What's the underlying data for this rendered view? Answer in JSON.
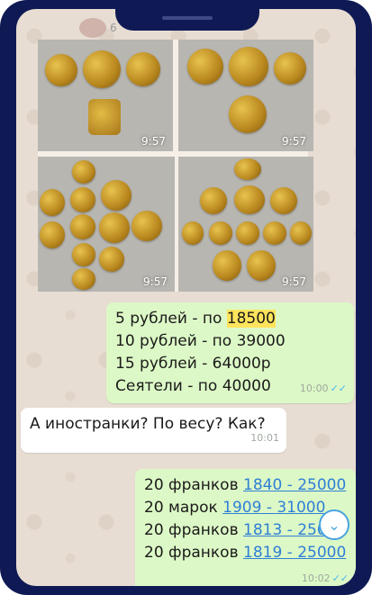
{
  "header": {
    "avatar_caption": "6"
  },
  "photos": [
    {
      "time": "9:57"
    },
    {
      "time": "9:57"
    },
    {
      "time": "9:57"
    },
    {
      "time": "9:57"
    }
  ],
  "msg_prices": {
    "line1_prefix": "5 рублей - по ",
    "line1_value": "18500",
    "line2": "10 рублей - по 39000",
    "line3": "15 рублей - 64000р",
    "line4": "Сеятели - по 40000",
    "time": "10:00",
    "ticks": "✓✓"
  },
  "msg_question": {
    "text": "А иностранки? По весу? Как?",
    "time": "10:01"
  },
  "msg_links": {
    "rows": [
      {
        "prefix": "20 франков ",
        "link": "1840 - 25000"
      },
      {
        "prefix": "20 марок ",
        "link": "1909 - 31000"
      },
      {
        "prefix": "20 франков ",
        "link": "1813 - 2500"
      },
      {
        "prefix": "20 франков ",
        "link": "1819 - 25000"
      }
    ],
    "time": "10:02",
    "ticks": "✓✓"
  },
  "scroll_down": {
    "icon": "chevron-down-icon",
    "glyph": "⌄"
  },
  "colors": {
    "frame": "#0f1a55",
    "outgoing": "#dcf8c6",
    "incoming": "#ffffff",
    "link": "#2f7fd6",
    "highlight": "#ffe45c"
  }
}
